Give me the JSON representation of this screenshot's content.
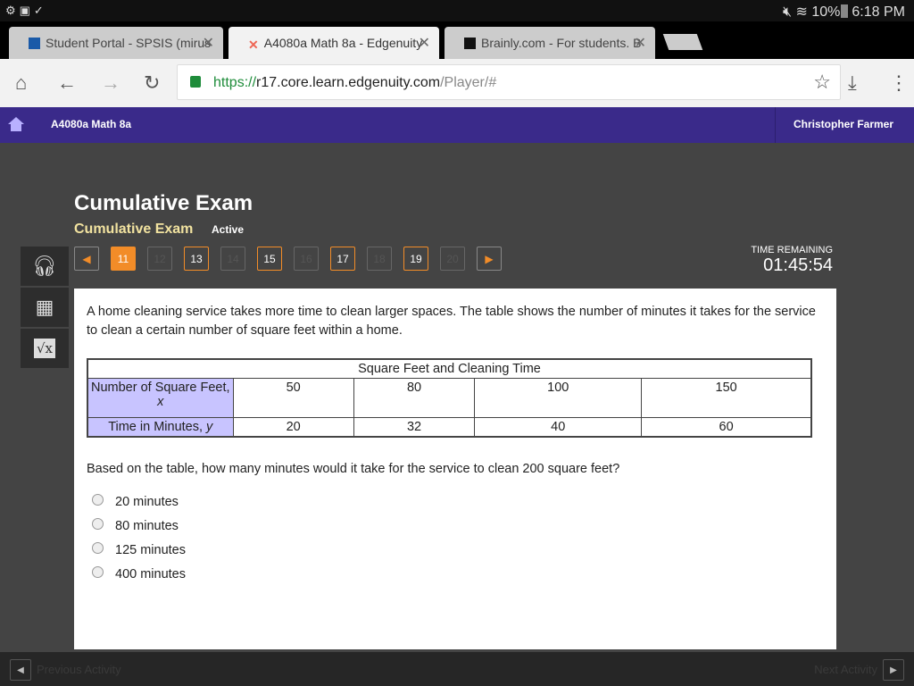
{
  "status": {
    "battery": "10%",
    "time": "6:18 PM"
  },
  "tabs": [
    {
      "label": "Student Portal - SPSIS (mirus"
    },
    {
      "label": "A4080a Math 8a - Edgenuity"
    },
    {
      "label": "Brainly.com - For students. B"
    }
  ],
  "url": {
    "scheme": "https://",
    "host": "r17.core.learn.edgenuity.com",
    "path": "/Player/#"
  },
  "appbar": {
    "course": "A4080a Math 8a",
    "user": "Christopher Farmer"
  },
  "exam": {
    "title": "Cumulative Exam",
    "subtitle": "Cumulative Exam",
    "state": "Active"
  },
  "pager": [
    "11",
    "12",
    "13",
    "14",
    "15",
    "16",
    "17",
    "18",
    "19",
    "20"
  ],
  "timer": {
    "label": "TIME REMAINING",
    "value": "01:45:54"
  },
  "question": {
    "prompt": "A home cleaning service takes more time to clean larger spaces. The table shows the number of minutes it takes for the service to clean a certain number of square feet within a home.",
    "table": {
      "caption": "Square Feet and Cleaning Time",
      "row1_label": "Number of Square Feet,",
      "row1_var": "x",
      "row1": [
        "50",
        "80",
        "100",
        "150"
      ],
      "row2_label": "Time in Minutes,",
      "row2_var": "y",
      "row2": [
        "20",
        "32",
        "40",
        "60"
      ]
    },
    "ask": "Based on the table, how many minutes would it take for the service to clean 200 square feet?",
    "options": [
      "20 minutes",
      "80 minutes",
      "125 minutes",
      "400 minutes"
    ]
  },
  "footer": {
    "prev": "Previous Activity",
    "next": "Next Activity"
  }
}
